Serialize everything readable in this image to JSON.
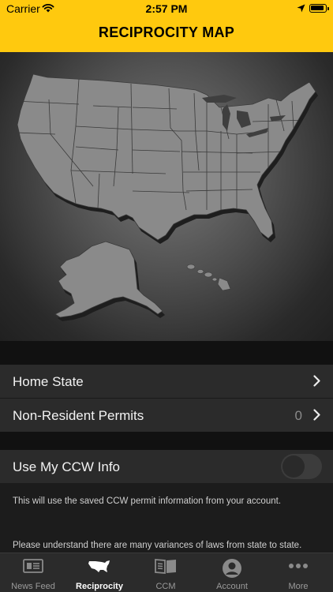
{
  "status_bar": {
    "carrier": "Carrier",
    "time": "2:57 PM"
  },
  "header": {
    "title": "RECIPROCITY MAP"
  },
  "settings": {
    "home_state_label": "Home State",
    "non_resident_label": "Non-Resident Permits",
    "non_resident_count": "0",
    "use_ccw_label": "Use My CCW Info",
    "use_ccw_enabled": false,
    "ccw_info_text": "This will use the saved CCW permit information from your account.",
    "variance_text": "Please understand there are many variances of laws from state to state."
  },
  "tabs": [
    {
      "label": "News Feed",
      "icon": "newspaper-icon"
    },
    {
      "label": "Reciprocity",
      "icon": "usa-map-icon",
      "active": true
    },
    {
      "label": "CCM",
      "icon": "magazine-icon"
    },
    {
      "label": "Account",
      "icon": "user-avatar-icon"
    },
    {
      "label": "More",
      "icon": "more-dots-icon"
    }
  ],
  "colors": {
    "accent": "#ffc90e",
    "background": "#1c1c1c",
    "row": "#2b2b2b",
    "state_fill": "#8a8a8a"
  }
}
